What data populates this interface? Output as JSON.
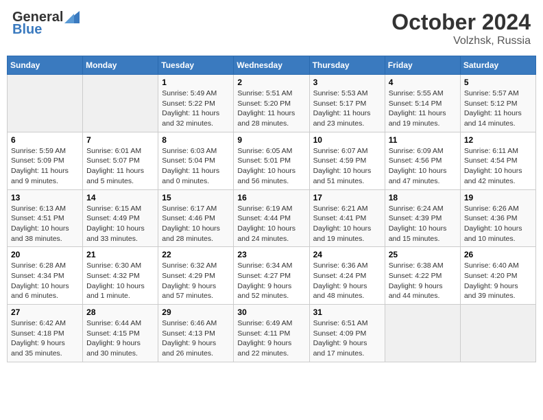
{
  "header": {
    "logo_general": "General",
    "logo_blue": "Blue",
    "title": "October 2024",
    "subtitle": "Volzhsk, Russia"
  },
  "weekdays": [
    "Sunday",
    "Monday",
    "Tuesday",
    "Wednesday",
    "Thursday",
    "Friday",
    "Saturday"
  ],
  "weeks": [
    [
      {
        "day": "",
        "info": ""
      },
      {
        "day": "",
        "info": ""
      },
      {
        "day": "1",
        "info": "Sunrise: 5:49 AM\nSunset: 5:22 PM\nDaylight: 11 hours and 32 minutes."
      },
      {
        "day": "2",
        "info": "Sunrise: 5:51 AM\nSunset: 5:20 PM\nDaylight: 11 hours and 28 minutes."
      },
      {
        "day": "3",
        "info": "Sunrise: 5:53 AM\nSunset: 5:17 PM\nDaylight: 11 hours and 23 minutes."
      },
      {
        "day": "4",
        "info": "Sunrise: 5:55 AM\nSunset: 5:14 PM\nDaylight: 11 hours and 19 minutes."
      },
      {
        "day": "5",
        "info": "Sunrise: 5:57 AM\nSunset: 5:12 PM\nDaylight: 11 hours and 14 minutes."
      }
    ],
    [
      {
        "day": "6",
        "info": "Sunrise: 5:59 AM\nSunset: 5:09 PM\nDaylight: 11 hours and 9 minutes."
      },
      {
        "day": "7",
        "info": "Sunrise: 6:01 AM\nSunset: 5:07 PM\nDaylight: 11 hours and 5 minutes."
      },
      {
        "day": "8",
        "info": "Sunrise: 6:03 AM\nSunset: 5:04 PM\nDaylight: 11 hours and 0 minutes."
      },
      {
        "day": "9",
        "info": "Sunrise: 6:05 AM\nSunset: 5:01 PM\nDaylight: 10 hours and 56 minutes."
      },
      {
        "day": "10",
        "info": "Sunrise: 6:07 AM\nSunset: 4:59 PM\nDaylight: 10 hours and 51 minutes."
      },
      {
        "day": "11",
        "info": "Sunrise: 6:09 AM\nSunset: 4:56 PM\nDaylight: 10 hours and 47 minutes."
      },
      {
        "day": "12",
        "info": "Sunrise: 6:11 AM\nSunset: 4:54 PM\nDaylight: 10 hours and 42 minutes."
      }
    ],
    [
      {
        "day": "13",
        "info": "Sunrise: 6:13 AM\nSunset: 4:51 PM\nDaylight: 10 hours and 38 minutes."
      },
      {
        "day": "14",
        "info": "Sunrise: 6:15 AM\nSunset: 4:49 PM\nDaylight: 10 hours and 33 minutes."
      },
      {
        "day": "15",
        "info": "Sunrise: 6:17 AM\nSunset: 4:46 PM\nDaylight: 10 hours and 28 minutes."
      },
      {
        "day": "16",
        "info": "Sunrise: 6:19 AM\nSunset: 4:44 PM\nDaylight: 10 hours and 24 minutes."
      },
      {
        "day": "17",
        "info": "Sunrise: 6:21 AM\nSunset: 4:41 PM\nDaylight: 10 hours and 19 minutes."
      },
      {
        "day": "18",
        "info": "Sunrise: 6:24 AM\nSunset: 4:39 PM\nDaylight: 10 hours and 15 minutes."
      },
      {
        "day": "19",
        "info": "Sunrise: 6:26 AM\nSunset: 4:36 PM\nDaylight: 10 hours and 10 minutes."
      }
    ],
    [
      {
        "day": "20",
        "info": "Sunrise: 6:28 AM\nSunset: 4:34 PM\nDaylight: 10 hours and 6 minutes."
      },
      {
        "day": "21",
        "info": "Sunrise: 6:30 AM\nSunset: 4:32 PM\nDaylight: 10 hours and 1 minute."
      },
      {
        "day": "22",
        "info": "Sunrise: 6:32 AM\nSunset: 4:29 PM\nDaylight: 9 hours and 57 minutes."
      },
      {
        "day": "23",
        "info": "Sunrise: 6:34 AM\nSunset: 4:27 PM\nDaylight: 9 hours and 52 minutes."
      },
      {
        "day": "24",
        "info": "Sunrise: 6:36 AM\nSunset: 4:24 PM\nDaylight: 9 hours and 48 minutes."
      },
      {
        "day": "25",
        "info": "Sunrise: 6:38 AM\nSunset: 4:22 PM\nDaylight: 9 hours and 44 minutes."
      },
      {
        "day": "26",
        "info": "Sunrise: 6:40 AM\nSunset: 4:20 PM\nDaylight: 9 hours and 39 minutes."
      }
    ],
    [
      {
        "day": "27",
        "info": "Sunrise: 6:42 AM\nSunset: 4:18 PM\nDaylight: 9 hours and 35 minutes."
      },
      {
        "day": "28",
        "info": "Sunrise: 6:44 AM\nSunset: 4:15 PM\nDaylight: 9 hours and 30 minutes."
      },
      {
        "day": "29",
        "info": "Sunrise: 6:46 AM\nSunset: 4:13 PM\nDaylight: 9 hours and 26 minutes."
      },
      {
        "day": "30",
        "info": "Sunrise: 6:49 AM\nSunset: 4:11 PM\nDaylight: 9 hours and 22 minutes."
      },
      {
        "day": "31",
        "info": "Sunrise: 6:51 AM\nSunset: 4:09 PM\nDaylight: 9 hours and 17 minutes."
      },
      {
        "day": "",
        "info": ""
      },
      {
        "day": "",
        "info": ""
      }
    ]
  ]
}
